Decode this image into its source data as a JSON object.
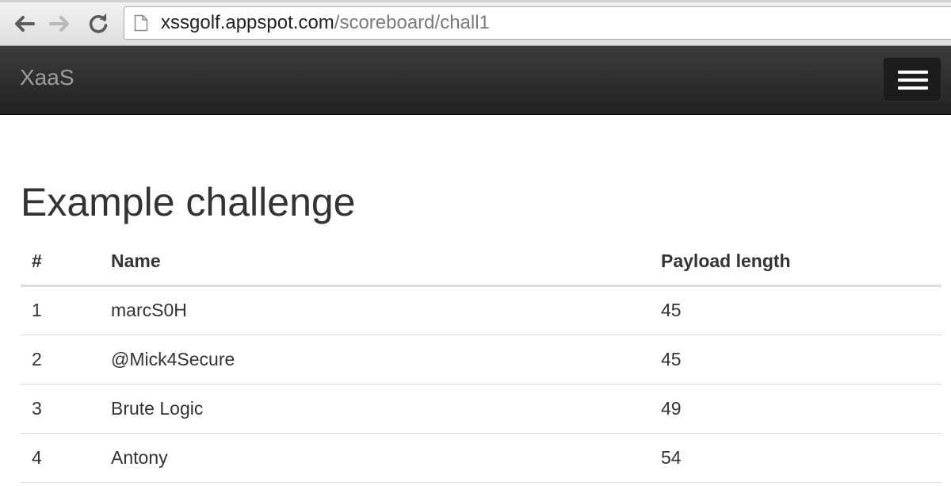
{
  "browser": {
    "url_host": "xssgolf.appspot.com",
    "url_path": "/scoreboard/chall1",
    "icons": [
      "back-arrow-icon",
      "forward-arrow-icon",
      "reload-icon",
      "page-icon"
    ]
  },
  "navbar": {
    "brand": "XaaS",
    "toggle_icon": "hamburger-menu-icon",
    "background": "#222222",
    "brand_color": "#9d9d9d"
  },
  "main": {
    "title": "Example challenge",
    "table": {
      "headers": [
        "#",
        "Name",
        "Payload length"
      ],
      "rows": [
        [
          "1",
          "marcS0H",
          "45"
        ],
        [
          "2",
          "@Mick4Secure",
          "45"
        ],
        [
          "3",
          "Brute Logic",
          "49"
        ],
        [
          "4",
          "Antony",
          "54"
        ]
      ]
    }
  }
}
